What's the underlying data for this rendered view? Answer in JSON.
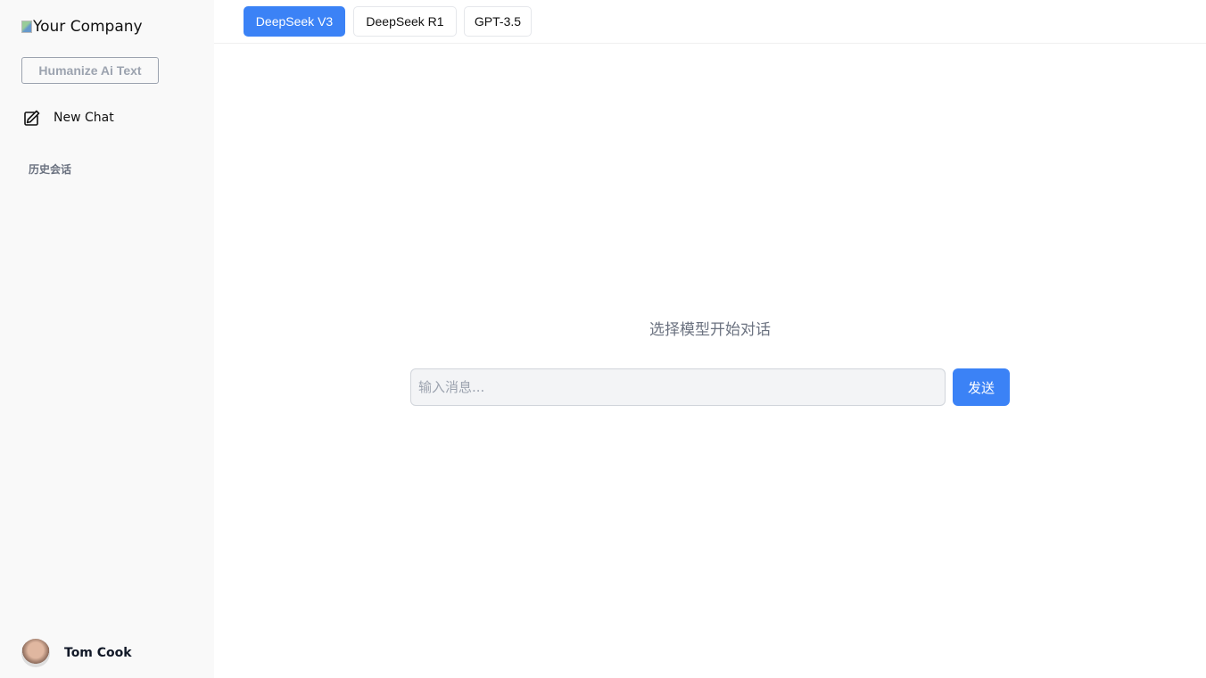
{
  "sidebar": {
    "logo_alt": "Your Company",
    "humanize_label": "Humanize Ai Text",
    "new_chat_label": "New Chat",
    "history_heading": "历史会话",
    "user_name": "Tom Cook"
  },
  "models": [
    {
      "label": "DeepSeek V3",
      "active": true
    },
    {
      "label": "DeepSeek R1",
      "active": false
    },
    {
      "label": "GPT-3.5",
      "active": false
    }
  ],
  "main": {
    "prompt": "选择模型开始对话",
    "input_placeholder": "输入消息...",
    "input_value": "",
    "send_label": "发送"
  },
  "colors": {
    "accent": "#3b82f6",
    "sidebar_bg": "#f9f9f9"
  }
}
